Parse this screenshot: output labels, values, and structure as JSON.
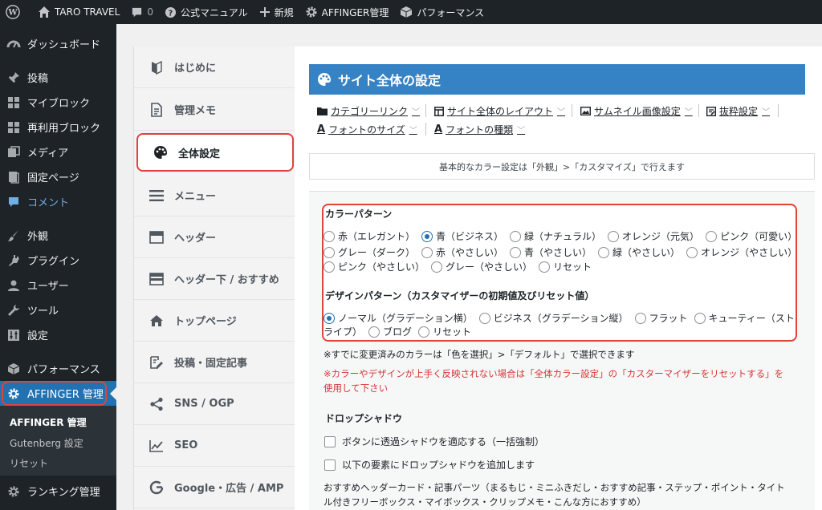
{
  "admin_bar": {
    "site_name": "TARO TRAVEL",
    "comment_count": "0",
    "manual": "公式マニュアル",
    "new": "新規",
    "affinger": "AFFINGER管理",
    "performance": "パフォーマンス"
  },
  "sidebar": {
    "dashboard": "ダッシュボード",
    "posts": "投稿",
    "my_blocks": "マイブロック",
    "reusable_blocks": "再利用ブロック",
    "media": "メディア",
    "pages": "固定ページ",
    "comments": "コメント",
    "appearance": "外観",
    "plugins": "プラグイン",
    "users": "ユーザー",
    "tools": "ツール",
    "settings": "設定",
    "performance": "パフォーマンス",
    "affinger": "AFFINGER 管理",
    "submenu": [
      "AFFINGER 管理",
      "Gutenberg 設定",
      "リセット"
    ],
    "ranking": "ランキング管理"
  },
  "plugin_nav": {
    "items": [
      "はじめに",
      "管理メモ",
      "全体設定",
      "メニュー",
      "ヘッダー",
      "ヘッダー下 / おすすめ",
      "トップページ",
      "投稿・固定記事",
      "SNS / OGP",
      "SEO",
      "Google・広告 / AMP"
    ],
    "active_index": 2
  },
  "main": {
    "title": "サイト全体の設定",
    "tabs": [
      "カテゴリーリンク",
      "サイト全体のレイアウト",
      "サムネイル画像設定",
      "抜粋設定",
      "フォントのサイズ",
      "フォントの種類"
    ],
    "note": "基本的なカラー設定は「外観」>「カスタマイズ」で行えます",
    "color_pattern": {
      "label": "カラーパターン",
      "options": [
        "赤（エレガント）",
        "青（ビジネス）",
        "緑（ナチュラル）",
        "オレンジ（元気）",
        "ピンク（可愛い）",
        "グレー（ダーク）",
        "赤（やさしい）",
        "青（やさしい）",
        "緑（やさしい）",
        "オレンジ（やさしい）",
        "ピンク（やさしい）",
        "グレー（やさしい）",
        "リセット"
      ],
      "selected": 1
    },
    "design_pattern": {
      "label": "デザインパターン（カスタマイザーの初期値及びリセット値）",
      "options": [
        "ノーマル（グラデーション横）",
        "ビジネス（グラデーション縦）",
        "フラット",
        "キューティー（スト",
        "ライプ）",
        "ブログ",
        "リセット"
      ],
      "selected": 0
    },
    "color_hint": "※すでに変更済みのカラーは「色を選択」>「デフォルト」で選択できます",
    "warning_line1": "※カラーやデザインが上手く反映されない場合は「全体カラー設定」の「カスターマイザーをリセットする」を",
    "warning_line2": "使用して下さい",
    "drop_shadow": {
      "label": "ドロップシャドウ",
      "options": [
        "ボタンに透過シャドウを適応する（一括強制）",
        "以下の要素にドロップシャドウを追加します"
      ],
      "desc_line1": "おすすめヘッダーカード・記事パーツ（まるもじ・ミニふきだし・おすすめ記事・ステップ・ポイント・タイト",
      "desc_line2": "ル付きフリーボックス・マイボックス・クリップメモ・こんな方におすすめ）"
    }
  },
  "colors": {
    "admin_dark": "#1d2327",
    "wp_blue": "#2271b1",
    "title_blue": "#3582c4",
    "highlight_red": "#e0433b",
    "warning_red": "#d63638"
  }
}
